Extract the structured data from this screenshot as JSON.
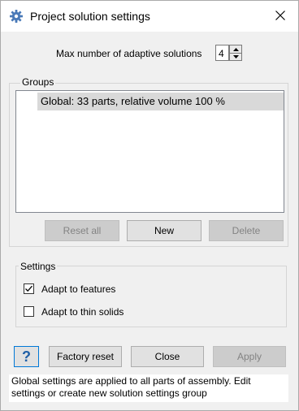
{
  "window": {
    "title": "Project solution settings",
    "title_icon": "gear-icon",
    "close_icon": "close-icon"
  },
  "adaptive": {
    "label": "Max number of adaptive solutions",
    "value": "4"
  },
  "groups": {
    "label": "Groups",
    "items": [
      {
        "label": "Global:  33 parts, relative volume 100 %",
        "selected": true
      }
    ],
    "buttons": {
      "reset_all": "Reset all",
      "new": "New",
      "delete": "Delete"
    }
  },
  "settings": {
    "label": "Settings",
    "options": [
      {
        "label": "Adapt to features",
        "checked": true
      },
      {
        "label": "Adapt to thin solids",
        "checked": false
      }
    ]
  },
  "footer": {
    "help_label": "?",
    "factory_reset": "Factory reset",
    "close": "Close",
    "apply": "Apply"
  },
  "info": {
    "line1": "Global settings are applied to all parts of assembly. Edit",
    "line2": "settings or create new solution settings group"
  },
  "colors": {
    "accent": "#0078d7",
    "selection": "#d9d9d9",
    "disabled_text": "#838383"
  }
}
